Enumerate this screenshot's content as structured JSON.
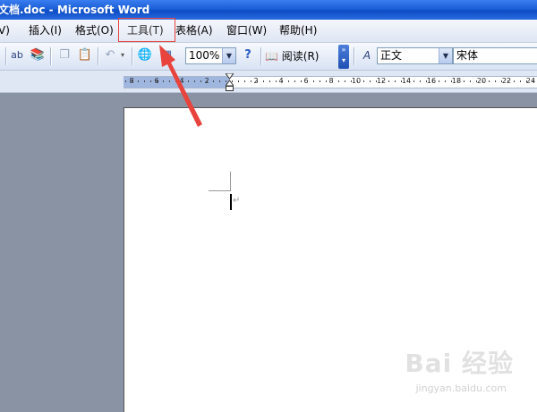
{
  "window": {
    "title": "文档.doc - Microsoft Word"
  },
  "menu": {
    "items": [
      {
        "label": "V)"
      },
      {
        "label": "插入(I)"
      },
      {
        "label": "格式(O)"
      },
      {
        "label": "工具(T)"
      },
      {
        "label": "表格(A)"
      },
      {
        "label": "窗口(W)"
      },
      {
        "label": "帮助(H)"
      }
    ]
  },
  "toolbar": {
    "zoom": "100%",
    "read_label": "阅读(R)",
    "style": "正文",
    "font": "宋体",
    "icons": [
      "spelling-icon",
      "research-icon",
      "copy-icon",
      "paste-icon",
      "undo-icon",
      "hyperlink-icon",
      "table-icon",
      "help-icon",
      "read-icon",
      "styles-icon"
    ]
  },
  "ruler": {
    "numbers": [
      "8",
      "6",
      "4",
      "2",
      "2",
      "4",
      "6",
      "8",
      "10",
      "12",
      "14",
      "16",
      "18",
      "20",
      "22",
      "24"
    ]
  },
  "document": {
    "paragraph_mark": "↵"
  },
  "watermark": {
    "brand": "Bai 经验",
    "url": "jingyan.baidu.com"
  },
  "colors": {
    "title_bar": "#1c5fd6",
    "highlight": "#e8433c",
    "workspace": "#8a93a3"
  }
}
